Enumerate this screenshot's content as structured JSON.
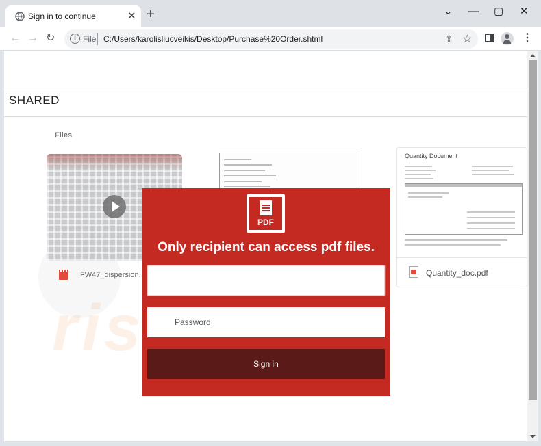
{
  "browser": {
    "tab_title": "Sign in to continue",
    "tab_close": "✕",
    "new_tab": "+",
    "minimize": "⌄",
    "maximize": "▢",
    "restore": "—",
    "close": "✕",
    "back": "←",
    "forward": "→",
    "reload": "↻",
    "info": "i",
    "scheme": "File",
    "url": "C:/Users/karolisliucveikis/Desktop/Purchase%20Order.shtml",
    "share": "⇪",
    "star": "☆",
    "menu": "⋮"
  },
  "page": {
    "section_title": "SHARED",
    "files_label": "Files",
    "video_card": {
      "name": "FW47_dispersion."
    },
    "quantity_card": {
      "title": "Quantity Document",
      "name": "Quantity_doc.pdf"
    },
    "watermark": "risk.com"
  },
  "modal": {
    "logo_text": "PDF",
    "heading": "Only recipient can access pdf files.",
    "email_value": "",
    "password_placeholder": "Password",
    "signin_label": "Sign in",
    "brand_color": "#c42a22",
    "button_color": "#5a1a17"
  }
}
